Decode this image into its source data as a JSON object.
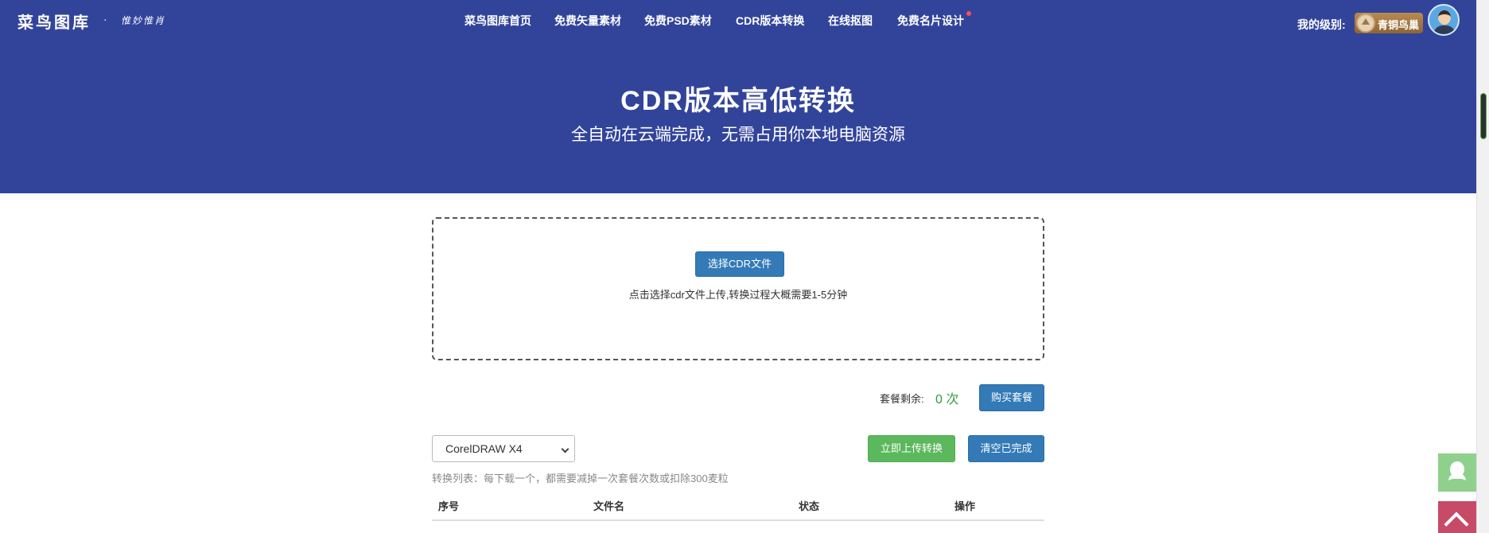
{
  "header": {
    "logo": "菜鸟图库",
    "logo_dot": "·",
    "slogan": "惟妙惟肖",
    "nav": [
      {
        "label": "菜鸟图库首页"
      },
      {
        "label": "免费矢量素材"
      },
      {
        "label": "免费PSD素材"
      },
      {
        "label": "CDR版本转换"
      },
      {
        "label": "在线抠图"
      },
      {
        "label": "免费名片设计"
      }
    ],
    "level_label": "我的级别:",
    "level_badge": "青铜鸟巢"
  },
  "hero": {
    "title": "CDR版本高低转换",
    "subtitle": "全自动在云端完成，无需占用你本地电脑资源"
  },
  "upload": {
    "button_label": "选择CDR文件",
    "hint": "点击选择cdr文件上传,转换过程大概需要1-5分钟"
  },
  "quota": {
    "label": "套餐剩余:",
    "value": "0 次",
    "buy_label": "购买套餐"
  },
  "controls": {
    "version_selected": "CorelDRAW X4",
    "upload_now_label": "立即上传转换",
    "clear_label": "清空已完成"
  },
  "list": {
    "hint": "转换列表：每下载一个，都需要减掉一次套餐次数或扣除300麦粒",
    "columns": [
      "序号",
      "文件名",
      "状态",
      "操作"
    ]
  },
  "colors": {
    "hero_bg": "#32449a",
    "primary_button": "#337ab7",
    "success_button": "#5cb85c",
    "quota_value": "#2e9e3f"
  }
}
